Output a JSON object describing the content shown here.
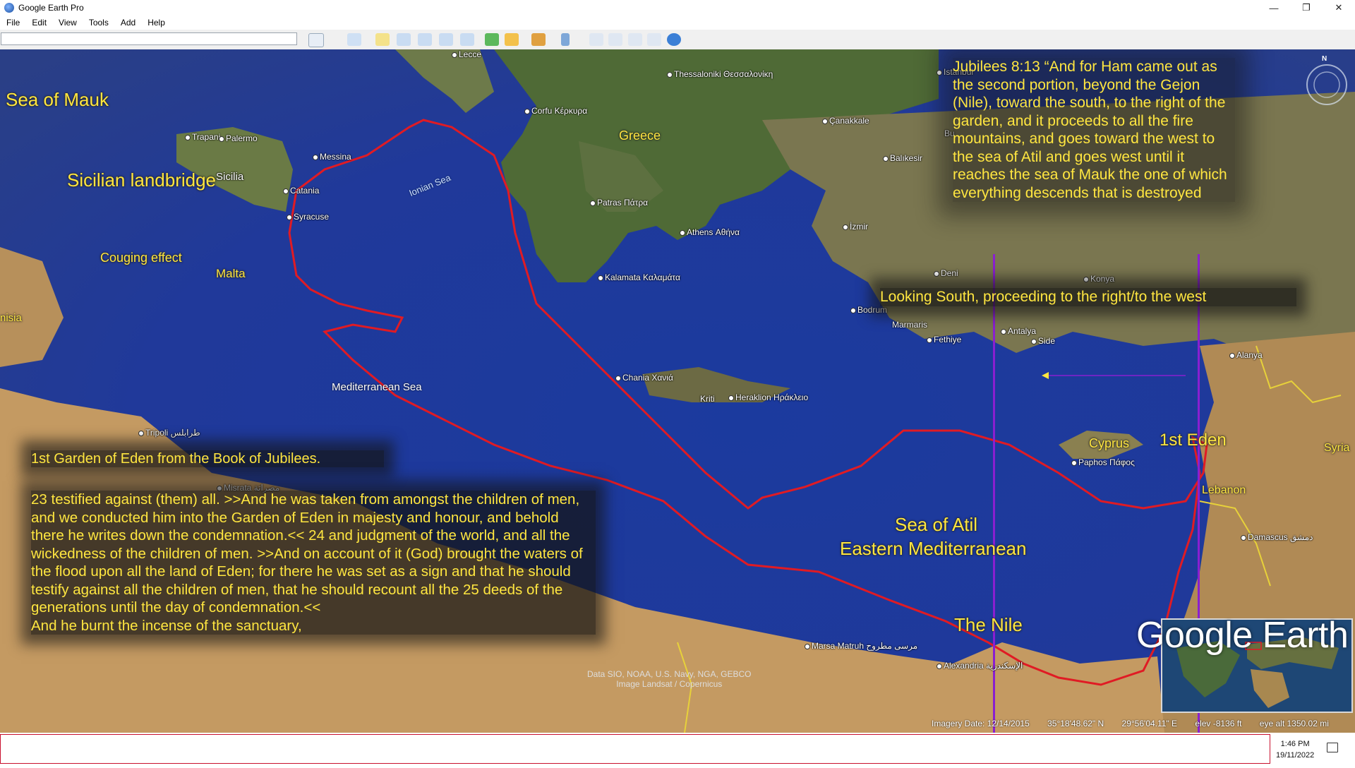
{
  "window": {
    "title": "Google Earth Pro",
    "minimize": "—",
    "restore": "❐",
    "close": "✕"
  },
  "menu": [
    "File",
    "Edit",
    "View",
    "Tools",
    "Add",
    "Help"
  ],
  "search": {
    "value": ""
  },
  "map_labels": {
    "sea_of_mauk": "Sea of Mauk",
    "sicilian_landbridge": "Sicilian landbridge",
    "couging_effect": "Couging effect",
    "malta": "Malta",
    "greece": "Greece",
    "sicilia": "Sicilia",
    "ionian_sea": "Ionian Sea",
    "mediterranean_sea": "Mediterranean Sea",
    "first_eden": "1st Eden",
    "cyprus": "Cyprus",
    "lebanon": "Lebanon",
    "syria": "Syria",
    "sea_of_atil_1": "Sea of Atil",
    "sea_of_atil_2": "Eastern Mediterranean",
    "the_nile": "The Nile",
    "nisia": "nisia",
    "marmaris": "Marmaris"
  },
  "places": [
    {
      "name": "Lecce"
    },
    {
      "name": "Thessaloniki Θεσσαλονίκη"
    },
    {
      "name": "Istanbul"
    },
    {
      "name": "Corfu Κέρκυρα"
    },
    {
      "name": "Çanakkale"
    },
    {
      "name": "Trapani"
    },
    {
      "name": "Palermo"
    },
    {
      "name": "Messina"
    },
    {
      "name": "Balıkesir"
    },
    {
      "name": "Catania"
    },
    {
      "name": "Patras Πάτρα"
    },
    {
      "name": "Syracuse"
    },
    {
      "name": "Athens Αθήνα"
    },
    {
      "name": "İzmir"
    },
    {
      "name": "Kalamata Καλαμάτα"
    },
    {
      "name": "Konya"
    },
    {
      "name": "Bodrum"
    },
    {
      "name": "Fethiye"
    },
    {
      "name": "Antalya"
    },
    {
      "name": "Side"
    },
    {
      "name": "Alanya"
    },
    {
      "name": "Chania Χανιά"
    },
    {
      "name": "Kriti"
    },
    {
      "name": "Heraklion Ηράκλειο"
    },
    {
      "name": "Tripoli طرابلس"
    },
    {
      "name": "Misrata مصراتة"
    },
    {
      "name": "Paphos Πάφος"
    },
    {
      "name": "Damascus دمشق"
    },
    {
      "name": "Marsa Matruh مرسى مطروح"
    },
    {
      "name": "Alexandria الإسكندرية"
    },
    {
      "name": "Deni"
    },
    {
      "name": "Bu"
    }
  ],
  "notes": {
    "jubilees": "Jubilees 8:13 “And for Ham came out as the second portion, beyond the Gejon (Nile), toward the south, to the right of the garden, and it proceeds to all the fire mountains, and goes toward the west to the sea of Atil and goes west until it reaches the sea of Mauk the one of which everything descends that is destroyed",
    "looking_south": "Looking South, proceeding to the right/to the west",
    "eden_title": "1st Garden of Eden from the Book of Jubilees.",
    "eden_body": "23 testified against (them) all. >>And he was taken from amongst the children of men, and we conducted him into the Garden of Eden in majesty and honour, and behold there he writes down the condemnation.<<  24 and judgment of the world, and all the wickedness of the children of men.   >>And on account of it (God) brought the waters of the flood upon all the land of Eden;  for there he was set as a sign and that he should testify against all the children of men, that he should recount all the 25 deeds of the generations until the day of condemnation.<<",
    "eden_last": " And he burnt the incense of the sanctuary,"
  },
  "attribution": {
    "line1": "Data SIO, NOAA, U.S. Navy, NGA, GEBCO",
    "line2": "Image Landsat / Copernicus"
  },
  "status": {
    "imagery_date": "Imagery Date: 12/14/2015",
    "lat": "35°18'48.62\" N",
    "lon": "29°56'04.11\" E",
    "elev": "elev -8136 ft",
    "eye_alt": "eye alt 1350.02 mi"
  },
  "logo": "Google Earth",
  "compass": "N",
  "taskbar": {
    "time": "1:46 PM",
    "date": "19/11/2022"
  },
  "colors": {
    "route": "#e01b24",
    "annotation": "#ffe640",
    "purple_guides": "#8a1fd0"
  }
}
